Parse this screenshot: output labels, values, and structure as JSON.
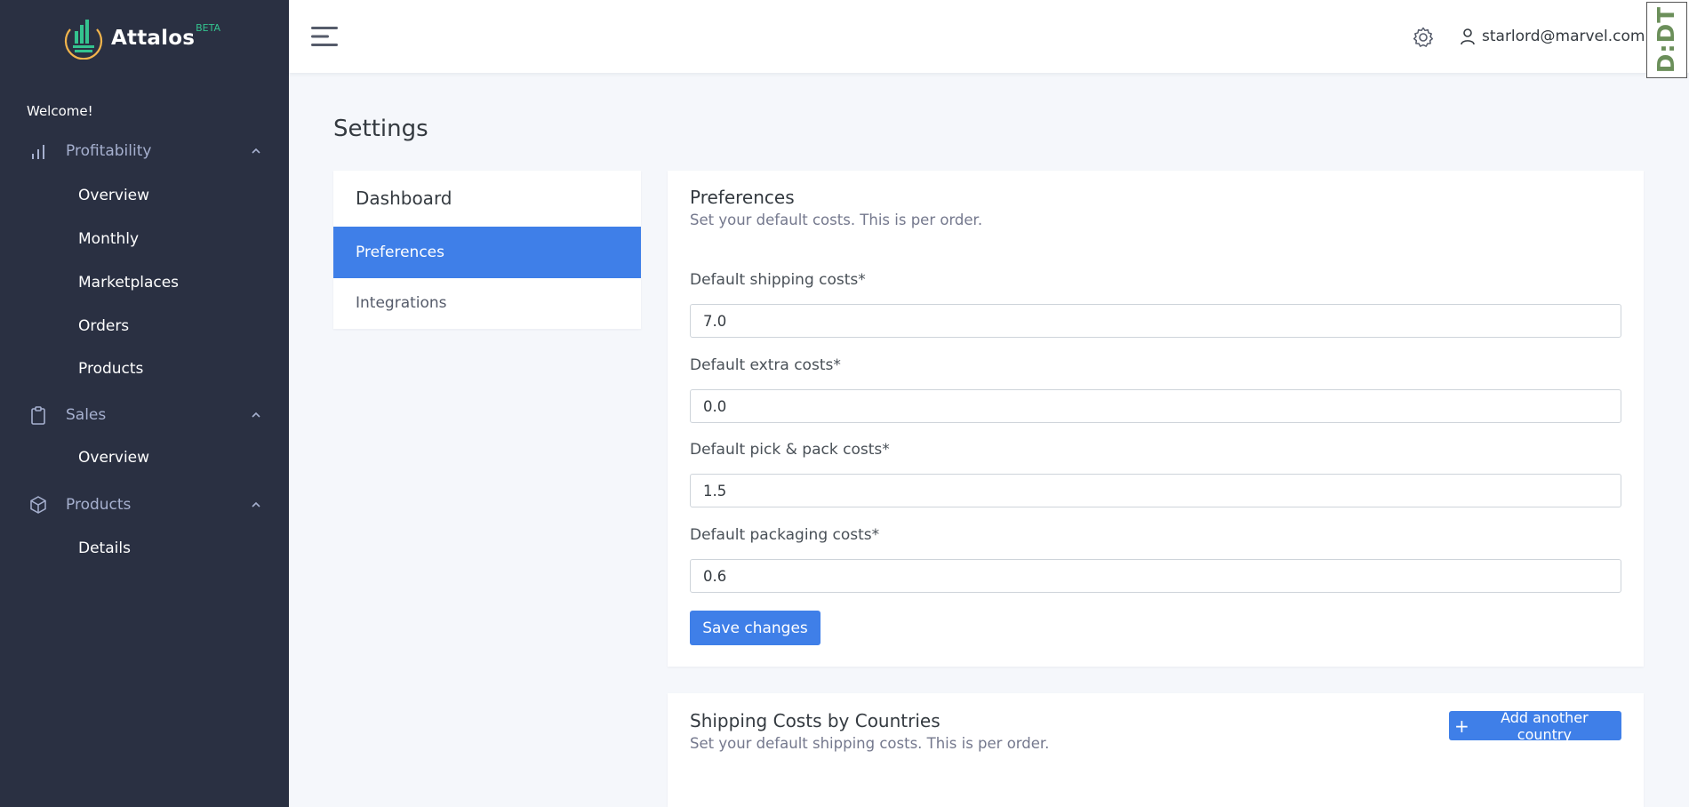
{
  "brand": {
    "name": "Attalos",
    "tag": "BETA"
  },
  "sidebar": {
    "welcome": "Welcome!",
    "groups": [
      {
        "label": "Profitability",
        "icon": "bar-chart-icon",
        "items": [
          "Overview",
          "Monthly",
          "Marketplaces",
          "Orders",
          "Products"
        ]
      },
      {
        "label": "Sales",
        "icon": "clipboard-icon",
        "items": [
          "Overview"
        ]
      },
      {
        "label": "Products",
        "icon": "cube-icon",
        "items": [
          "Details"
        ]
      }
    ]
  },
  "topbar": {
    "user_email": "starlord@marvel.com",
    "badge_text": "D:DT"
  },
  "page": {
    "title": "Settings"
  },
  "settings_menu": {
    "title": "Dashboard",
    "items": [
      "Preferences",
      "Integrations"
    ],
    "active": "Preferences"
  },
  "preferences": {
    "title": "Preferences",
    "subtitle": "Set your default costs. This is per order.",
    "fields": [
      {
        "label": "Default shipping costs*",
        "value": "7.0"
      },
      {
        "label": "Default extra costs*",
        "value": "0.0"
      },
      {
        "label": "Default pick & pack costs*",
        "value": "1.5"
      },
      {
        "label": "Default packaging costs*",
        "value": "0.6"
      }
    ],
    "save_label": "Save changes"
  },
  "shipping": {
    "title": "Shipping Costs by Countries",
    "subtitle": "Set your default shipping costs. This is per order.",
    "add_label": "Add another country"
  },
  "colors": {
    "sidebar": "#2a3042",
    "primary": "#3f7fe8",
    "accent": "#34c38f",
    "logo_ring": "#f1b44c"
  }
}
